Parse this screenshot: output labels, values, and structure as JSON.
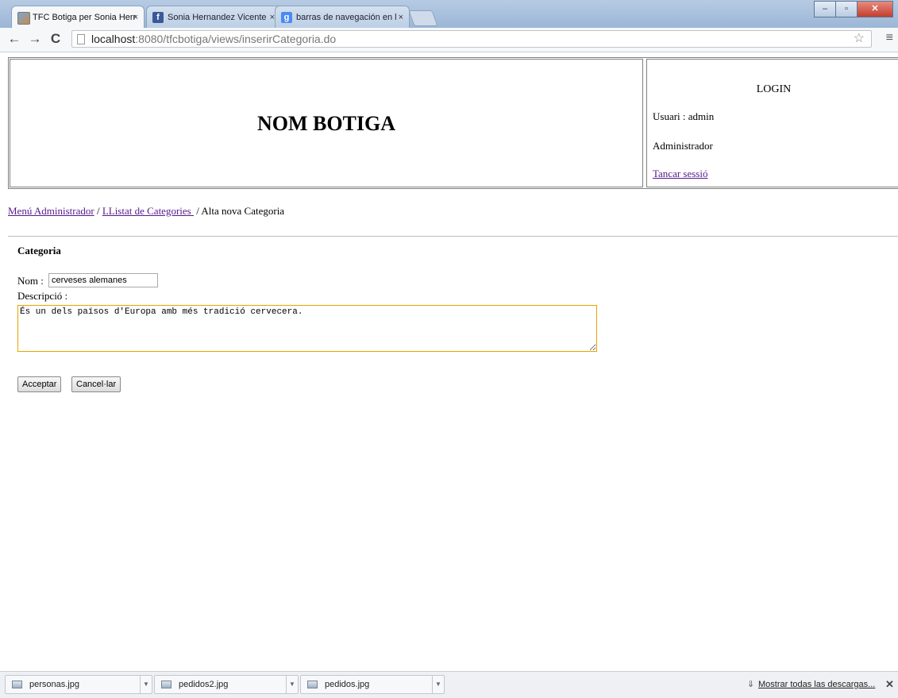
{
  "browser": {
    "tabs": [
      {
        "title": "TFC Botiga per Sonia Herr",
        "favicon": "image-icon",
        "active": true
      },
      {
        "title": "Sonia Hernandez Vicente",
        "favicon": "facebook-icon",
        "active": false
      },
      {
        "title": "barras de navegación en l",
        "favicon": "google-icon",
        "active": false
      }
    ],
    "tab_close_glyph": "×",
    "url_host": "localhost",
    "url_rest": ":8080/tfcbotiga/views/inserirCategoria.do",
    "colors": {
      "facebook": "#3b5998",
      "google": "#4a8af4",
      "accent_border": "#e5a500",
      "link": "#551a8b"
    }
  },
  "header": {
    "shop_name": "NOM BOTIGA",
    "login_title": "LOGIN",
    "user_line": "Usuari : admin",
    "role": "Administrador",
    "logout_link": "Tancar sessió"
  },
  "breadcrumb": {
    "admin_menu": "Menú Administrador",
    "separator": " / ",
    "category_list": "LListat de Categories ",
    "current": "Alta nova Categoria"
  },
  "form": {
    "title": "Categoria",
    "nom_label": "Nom :",
    "nom_value": "cerveses alemanes",
    "desc_label": "Descripció :",
    "desc_value": "És un dels països d'Europa amb més tradició cervecera. ",
    "accept_label": "Acceptar",
    "cancel_label": "Cancel·lar"
  },
  "downloads": {
    "items": [
      {
        "name": "personas.jpg"
      },
      {
        "name": "pedidos2.jpg"
      },
      {
        "name": "pedidos.jpg"
      }
    ],
    "show_all": "Mostrar todas las descargas...",
    "close_glyph": "✕"
  }
}
